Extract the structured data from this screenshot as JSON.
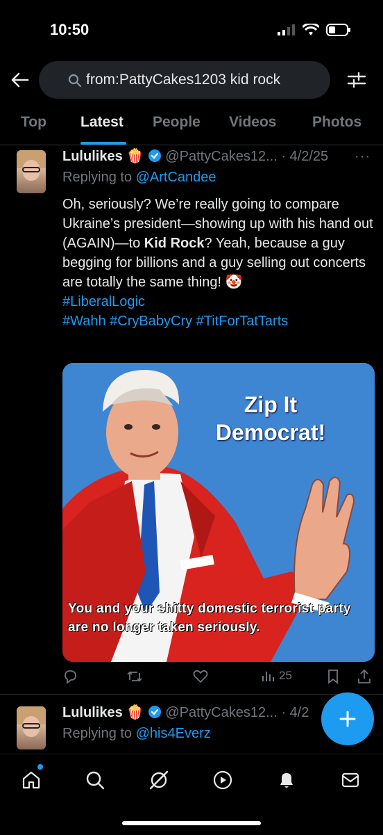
{
  "status_bar": {
    "time": "10:50"
  },
  "search": {
    "query": "from:PattyCakes1203 kid rock"
  },
  "tabs": [
    {
      "label": "Top"
    },
    {
      "label": "Latest"
    },
    {
      "label": "People"
    },
    {
      "label": "Videos"
    },
    {
      "label": "Photos"
    }
  ],
  "active_tab": "Latest",
  "colors": {
    "accent": "#1d9bf0",
    "background": "#000000",
    "muted": "#71767b"
  },
  "tweets": [
    {
      "name": "Lululikes",
      "name_emoji": "🍿",
      "handle": "@PattyCakes12...",
      "date": "· 4/2/25",
      "more": "···",
      "reply_prefix": "Replying to",
      "reply_to": "@ArtCandee",
      "text_before_bold": "Oh, seriously? We’re really going to compare Ukraine’s president—showing up with his hand out (AGAIN)—to ",
      "text_bold": "Kid Rock",
      "text_after_bold": "? Yeah, because a guy begging for billions and a guy selling out concerts are totally the same thing! ",
      "text_emoji": "🤡",
      "hashtag_line1": "#LiberalLogic",
      "hashtag_line2": "#Wahh #CryBabyCry #TitForTatTarts",
      "media": {
        "headline_line1": "Zip It",
        "headline_line2": "Democrat!",
        "caption": "You and your shitty domestic terrorist party are no longer taken seriously."
      },
      "views": "25"
    },
    {
      "name": "Lululikes",
      "name_emoji": "🍿",
      "handle": "@PattyCakes12...",
      "date": "· 4/2",
      "reply_prefix": "Replying to",
      "reply_to": "@his4Everz"
    }
  ],
  "icons": [
    "back-arrow-icon",
    "search-icon",
    "filter-icon",
    "verified-badge-icon",
    "reply-icon",
    "repost-icon",
    "like-icon",
    "views-icon",
    "bookmark-icon",
    "share-icon",
    "compose-plus-icon",
    "home-icon",
    "explore-icon",
    "grok-icon",
    "video-icon",
    "notifications-icon",
    "messages-icon"
  ]
}
